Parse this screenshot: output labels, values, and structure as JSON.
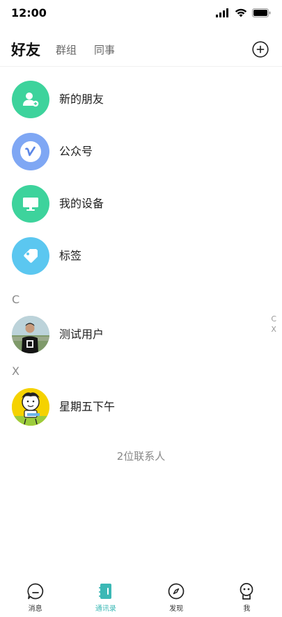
{
  "status_bar": {
    "time": "12:00"
  },
  "header": {
    "tabs": [
      {
        "label": "好友",
        "active": true
      },
      {
        "label": "群组",
        "active": false
      },
      {
        "label": "同事",
        "active": false
      }
    ]
  },
  "functions": [
    {
      "label": "新的朋友",
      "icon": "add-friend-icon",
      "color": "#3dd39c"
    },
    {
      "label": "公众号",
      "icon": "official-account-icon",
      "color": "#7fa7f4"
    },
    {
      "label": "我的设备",
      "icon": "device-icon",
      "color": "#3dd39c"
    },
    {
      "label": "标签",
      "icon": "tag-icon",
      "color": "#5bc7f0"
    }
  ],
  "sections": [
    {
      "letter": "C",
      "contacts": [
        {
          "name": "测试用户"
        }
      ]
    },
    {
      "letter": "X",
      "contacts": [
        {
          "name": "星期五下午"
        }
      ]
    }
  ],
  "index_letters": [
    "C",
    "X"
  ],
  "footer": {
    "count_text": "2位联系人"
  },
  "tabbar": [
    {
      "label": "消息",
      "icon": "chat-icon",
      "active": false
    },
    {
      "label": "通讯录",
      "icon": "contacts-icon",
      "active": true
    },
    {
      "label": "发现",
      "icon": "compass-icon",
      "active": false
    },
    {
      "label": "我",
      "icon": "profile-icon",
      "active": false
    }
  ],
  "colors": {
    "accent": "#3bb8b5",
    "green": "#3dd39c",
    "blue": "#7fa7f4",
    "sky": "#5bc7f0"
  }
}
